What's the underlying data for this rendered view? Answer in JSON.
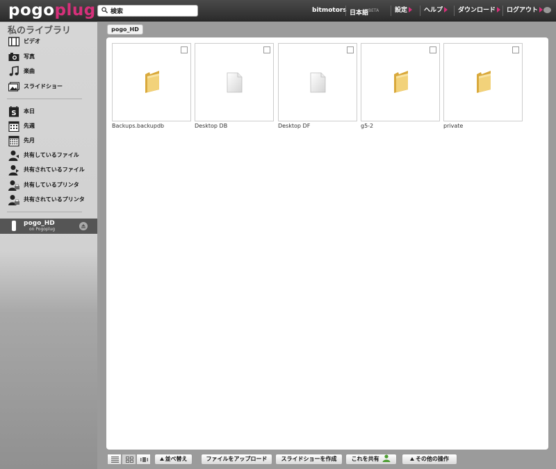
{
  "header": {
    "logo_pogo": "pogo",
    "logo_plug": "plug",
    "search_value": "検索",
    "username": "bitmotors",
    "language": "日本語",
    "language_badge": "BETA",
    "settings": "設定",
    "help": "ヘルプ",
    "download": "ダウンロード",
    "logout": "ログアウト"
  },
  "sidebar": {
    "title": "私のライブラリ",
    "media": [
      {
        "label": "ビデオ",
        "icon": "film-icon"
      },
      {
        "label": "写真",
        "icon": "camera-icon"
      },
      {
        "label": "楽曲",
        "icon": "music-note-icon"
      },
      {
        "label": "スライドショー",
        "icon": "slideshow-icon"
      }
    ],
    "activity": [
      {
        "label": "本日",
        "icon": "calendar-day-icon"
      },
      {
        "label": "先週",
        "icon": "calendar-week-icon"
      },
      {
        "label": "先月",
        "icon": "calendar-month-icon"
      },
      {
        "label": "共有しているファイル",
        "icon": "person-share-icon"
      },
      {
        "label": "共有されているファイル",
        "icon": "person-shared-icon"
      },
      {
        "label": "共有しているプリンタ",
        "icon": "person-printer-icon"
      },
      {
        "label": "共有されているプリンタ",
        "icon": "person-printer-shared-icon"
      }
    ],
    "device": {
      "name": "pogo_HD",
      "subtitle": "on Pogoplug"
    }
  },
  "breadcrumb": "pogo_HD",
  "files": [
    {
      "name": "Backups.backupdb",
      "kind": "folder"
    },
    {
      "name": "Desktop DB",
      "kind": "document"
    },
    {
      "name": "Desktop DF",
      "kind": "document"
    },
    {
      "name": "g5-2",
      "kind": "folder"
    },
    {
      "name": "private",
      "kind": "folder"
    }
  ],
  "toolbar": {
    "sort": "並べ替え",
    "upload": "ファイルをアップロード",
    "slideshow": "スライドショーを作成",
    "share": "これを共有",
    "more": "その他の操作"
  },
  "colors": {
    "accent": "#d6307a",
    "topbar": "#333333",
    "folder": "#e8c35a"
  }
}
